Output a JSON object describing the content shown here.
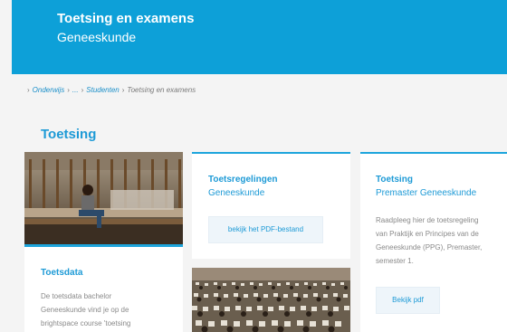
{
  "header": {
    "title": "Toetsing en examens",
    "subtitle": "Geneeskunde"
  },
  "breadcrumb": {
    "items": [
      "Onderwijs",
      "...",
      "Studenten",
      "Toetsing en examens"
    ]
  },
  "section": {
    "title": "Toetsing"
  },
  "cards": [
    {
      "title": "Toetsdata",
      "body": [
        "De toetsdata bachelor",
        "Geneeskunde vind je op de",
        "brightspace course 'toetsing"
      ]
    },
    {
      "title": "Toetsregelingen",
      "subtitle": "Geneeskunde",
      "button": "bekijk het PDF-bestand"
    },
    {
      "title": "Toetsing",
      "subtitle": "Premaster Geneeskunde",
      "body": [
        "Raadpleeg hier de toetsregeling",
        "van Praktijk en Principes van de",
        "Geneeskunde (PPG), Premaster,",
        "semester 1."
      ],
      "button": "Bekijk pdf"
    }
  ],
  "colors": {
    "brand": "#0da0d8",
    "accent": "#1d9ad6"
  }
}
